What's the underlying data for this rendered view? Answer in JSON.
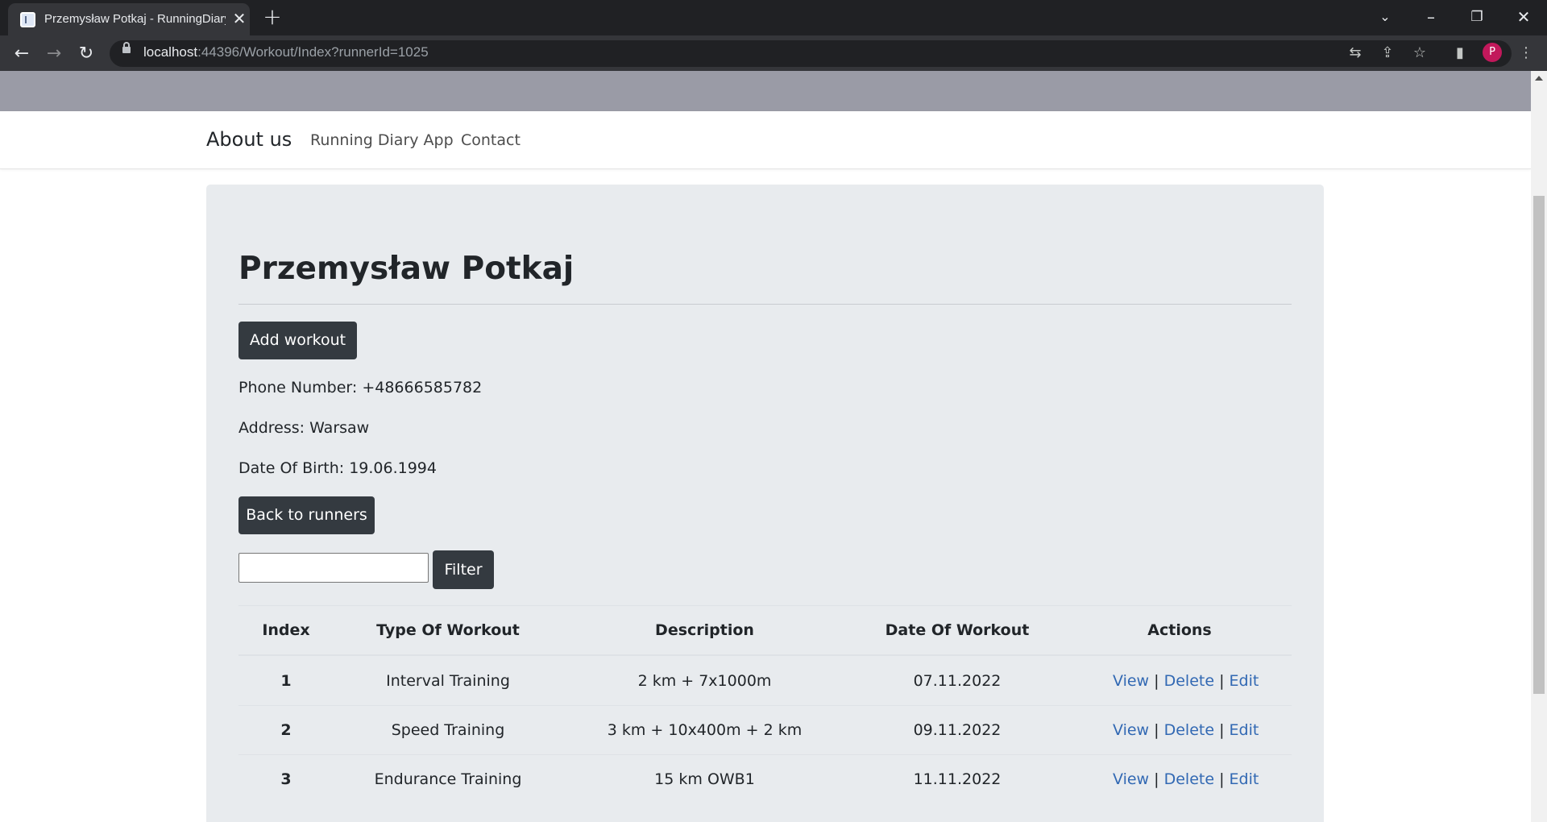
{
  "browser": {
    "tab_title": "Przemysław Potkaj - RunningDiary",
    "url_host": "localhost",
    "url_rest": ":44396/Workout/Index?runnerId=1025",
    "profile_initial": "P"
  },
  "navbar": {
    "brand": "About us",
    "links": [
      "Running Diary App",
      "Contact"
    ]
  },
  "runner": {
    "name": "Przemysław Potkaj",
    "add_workout_label": "Add workout",
    "phone": "Phone Number: +48666585782",
    "address": "Address: Warsaw",
    "dob": "Date Of Birth: 19.06.1994",
    "back_label": "Back to runners"
  },
  "filter": {
    "value": "",
    "button_label": "Filter"
  },
  "table": {
    "headers": [
      "Index",
      "Type Of Workout",
      "Description",
      "Date Of Workout",
      "Actions"
    ],
    "rows": [
      {
        "index": "1",
        "type": "Interval Training",
        "description": "2 km + 7x1000m",
        "date": "07.11.2022"
      },
      {
        "index": "2",
        "type": "Speed Training",
        "description": "3 km + 10x400m + 2 km",
        "date": "09.11.2022"
      },
      {
        "index": "3",
        "type": "Endurance Training",
        "description": "15 km OWB1",
        "date": "11.11.2022"
      }
    ],
    "action_labels": {
      "view": "View",
      "delete": "Delete",
      "edit": "Edit",
      "separator": "|"
    }
  }
}
